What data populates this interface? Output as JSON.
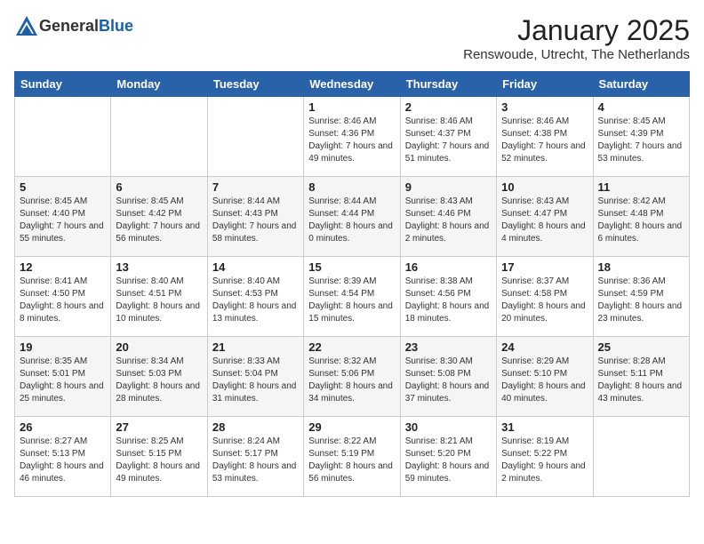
{
  "header": {
    "logo_general": "General",
    "logo_blue": "Blue",
    "month_title": "January 2025",
    "location": "Renswoude, Utrecht, The Netherlands"
  },
  "days_of_week": [
    "Sunday",
    "Monday",
    "Tuesday",
    "Wednesday",
    "Thursday",
    "Friday",
    "Saturday"
  ],
  "weeks": [
    [
      {
        "day": "",
        "info": ""
      },
      {
        "day": "",
        "info": ""
      },
      {
        "day": "",
        "info": ""
      },
      {
        "day": "1",
        "info": "Sunrise: 8:46 AM\nSunset: 4:36 PM\nDaylight: 7 hours\nand 49 minutes."
      },
      {
        "day": "2",
        "info": "Sunrise: 8:46 AM\nSunset: 4:37 PM\nDaylight: 7 hours\nand 51 minutes."
      },
      {
        "day": "3",
        "info": "Sunrise: 8:46 AM\nSunset: 4:38 PM\nDaylight: 7 hours\nand 52 minutes."
      },
      {
        "day": "4",
        "info": "Sunrise: 8:45 AM\nSunset: 4:39 PM\nDaylight: 7 hours\nand 53 minutes."
      }
    ],
    [
      {
        "day": "5",
        "info": "Sunrise: 8:45 AM\nSunset: 4:40 PM\nDaylight: 7 hours\nand 55 minutes."
      },
      {
        "day": "6",
        "info": "Sunrise: 8:45 AM\nSunset: 4:42 PM\nDaylight: 7 hours\nand 56 minutes."
      },
      {
        "day": "7",
        "info": "Sunrise: 8:44 AM\nSunset: 4:43 PM\nDaylight: 7 hours\nand 58 minutes."
      },
      {
        "day": "8",
        "info": "Sunrise: 8:44 AM\nSunset: 4:44 PM\nDaylight: 8 hours\nand 0 minutes."
      },
      {
        "day": "9",
        "info": "Sunrise: 8:43 AM\nSunset: 4:46 PM\nDaylight: 8 hours\nand 2 minutes."
      },
      {
        "day": "10",
        "info": "Sunrise: 8:43 AM\nSunset: 4:47 PM\nDaylight: 8 hours\nand 4 minutes."
      },
      {
        "day": "11",
        "info": "Sunrise: 8:42 AM\nSunset: 4:48 PM\nDaylight: 8 hours\nand 6 minutes."
      }
    ],
    [
      {
        "day": "12",
        "info": "Sunrise: 8:41 AM\nSunset: 4:50 PM\nDaylight: 8 hours\nand 8 minutes."
      },
      {
        "day": "13",
        "info": "Sunrise: 8:40 AM\nSunset: 4:51 PM\nDaylight: 8 hours\nand 10 minutes."
      },
      {
        "day": "14",
        "info": "Sunrise: 8:40 AM\nSunset: 4:53 PM\nDaylight: 8 hours\nand 13 minutes."
      },
      {
        "day": "15",
        "info": "Sunrise: 8:39 AM\nSunset: 4:54 PM\nDaylight: 8 hours\nand 15 minutes."
      },
      {
        "day": "16",
        "info": "Sunrise: 8:38 AM\nSunset: 4:56 PM\nDaylight: 8 hours\nand 18 minutes."
      },
      {
        "day": "17",
        "info": "Sunrise: 8:37 AM\nSunset: 4:58 PM\nDaylight: 8 hours\nand 20 minutes."
      },
      {
        "day": "18",
        "info": "Sunrise: 8:36 AM\nSunset: 4:59 PM\nDaylight: 8 hours\nand 23 minutes."
      }
    ],
    [
      {
        "day": "19",
        "info": "Sunrise: 8:35 AM\nSunset: 5:01 PM\nDaylight: 8 hours\nand 25 minutes."
      },
      {
        "day": "20",
        "info": "Sunrise: 8:34 AM\nSunset: 5:03 PM\nDaylight: 8 hours\nand 28 minutes."
      },
      {
        "day": "21",
        "info": "Sunrise: 8:33 AM\nSunset: 5:04 PM\nDaylight: 8 hours\nand 31 minutes."
      },
      {
        "day": "22",
        "info": "Sunrise: 8:32 AM\nSunset: 5:06 PM\nDaylight: 8 hours\nand 34 minutes."
      },
      {
        "day": "23",
        "info": "Sunrise: 8:30 AM\nSunset: 5:08 PM\nDaylight: 8 hours\nand 37 minutes."
      },
      {
        "day": "24",
        "info": "Sunrise: 8:29 AM\nSunset: 5:10 PM\nDaylight: 8 hours\nand 40 minutes."
      },
      {
        "day": "25",
        "info": "Sunrise: 8:28 AM\nSunset: 5:11 PM\nDaylight: 8 hours\nand 43 minutes."
      }
    ],
    [
      {
        "day": "26",
        "info": "Sunrise: 8:27 AM\nSunset: 5:13 PM\nDaylight: 8 hours\nand 46 minutes."
      },
      {
        "day": "27",
        "info": "Sunrise: 8:25 AM\nSunset: 5:15 PM\nDaylight: 8 hours\nand 49 minutes."
      },
      {
        "day": "28",
        "info": "Sunrise: 8:24 AM\nSunset: 5:17 PM\nDaylight: 8 hours\nand 53 minutes."
      },
      {
        "day": "29",
        "info": "Sunrise: 8:22 AM\nSunset: 5:19 PM\nDaylight: 8 hours\nand 56 minutes."
      },
      {
        "day": "30",
        "info": "Sunrise: 8:21 AM\nSunset: 5:20 PM\nDaylight: 8 hours\nand 59 minutes."
      },
      {
        "day": "31",
        "info": "Sunrise: 8:19 AM\nSunset: 5:22 PM\nDaylight: 9 hours\nand 2 minutes."
      },
      {
        "day": "",
        "info": ""
      }
    ]
  ]
}
